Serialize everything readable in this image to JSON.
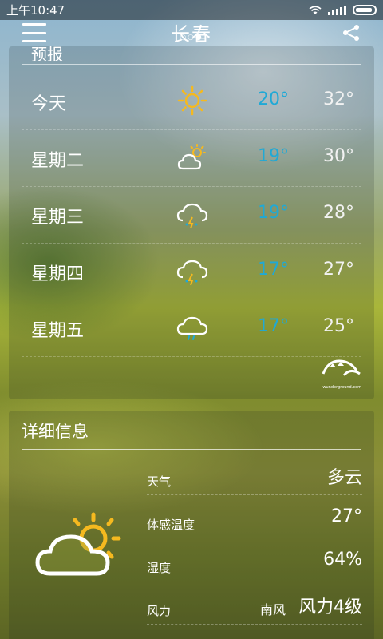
{
  "status_bar": {
    "time": "上午10:47"
  },
  "header": {
    "city": "长春",
    "page_dots": "○○●"
  },
  "forecast": {
    "title": "预报",
    "days": [
      {
        "name": "今天",
        "icon": "sun-icon",
        "low": "20°",
        "high": "32°"
      },
      {
        "name": "星期二",
        "icon": "partly-cloudy-icon",
        "low": "19°",
        "high": "30°"
      },
      {
        "name": "星期三",
        "icon": "thunder-rain-icon",
        "low": "19°",
        "high": "28°"
      },
      {
        "name": "星期四",
        "icon": "thunder-rain-icon",
        "low": "17°",
        "high": "27°"
      },
      {
        "name": "星期五",
        "icon": "rain-icon",
        "low": "17°",
        "high": "25°"
      }
    ],
    "provider_logo_text": "wunderground.com"
  },
  "details": {
    "title": "详细信息",
    "icon": "partly-cloudy-icon",
    "rows": [
      {
        "label": "天气",
        "value": "多云"
      },
      {
        "label": "体感温度",
        "value": "27°"
      },
      {
        "label": "湿度",
        "value": "64%"
      },
      {
        "label": "风力",
        "sub": "南风",
        "value": "风力4级"
      }
    ]
  },
  "colors": {
    "low_temp": "#1fa9d6",
    "sun": "#f5b91f"
  }
}
